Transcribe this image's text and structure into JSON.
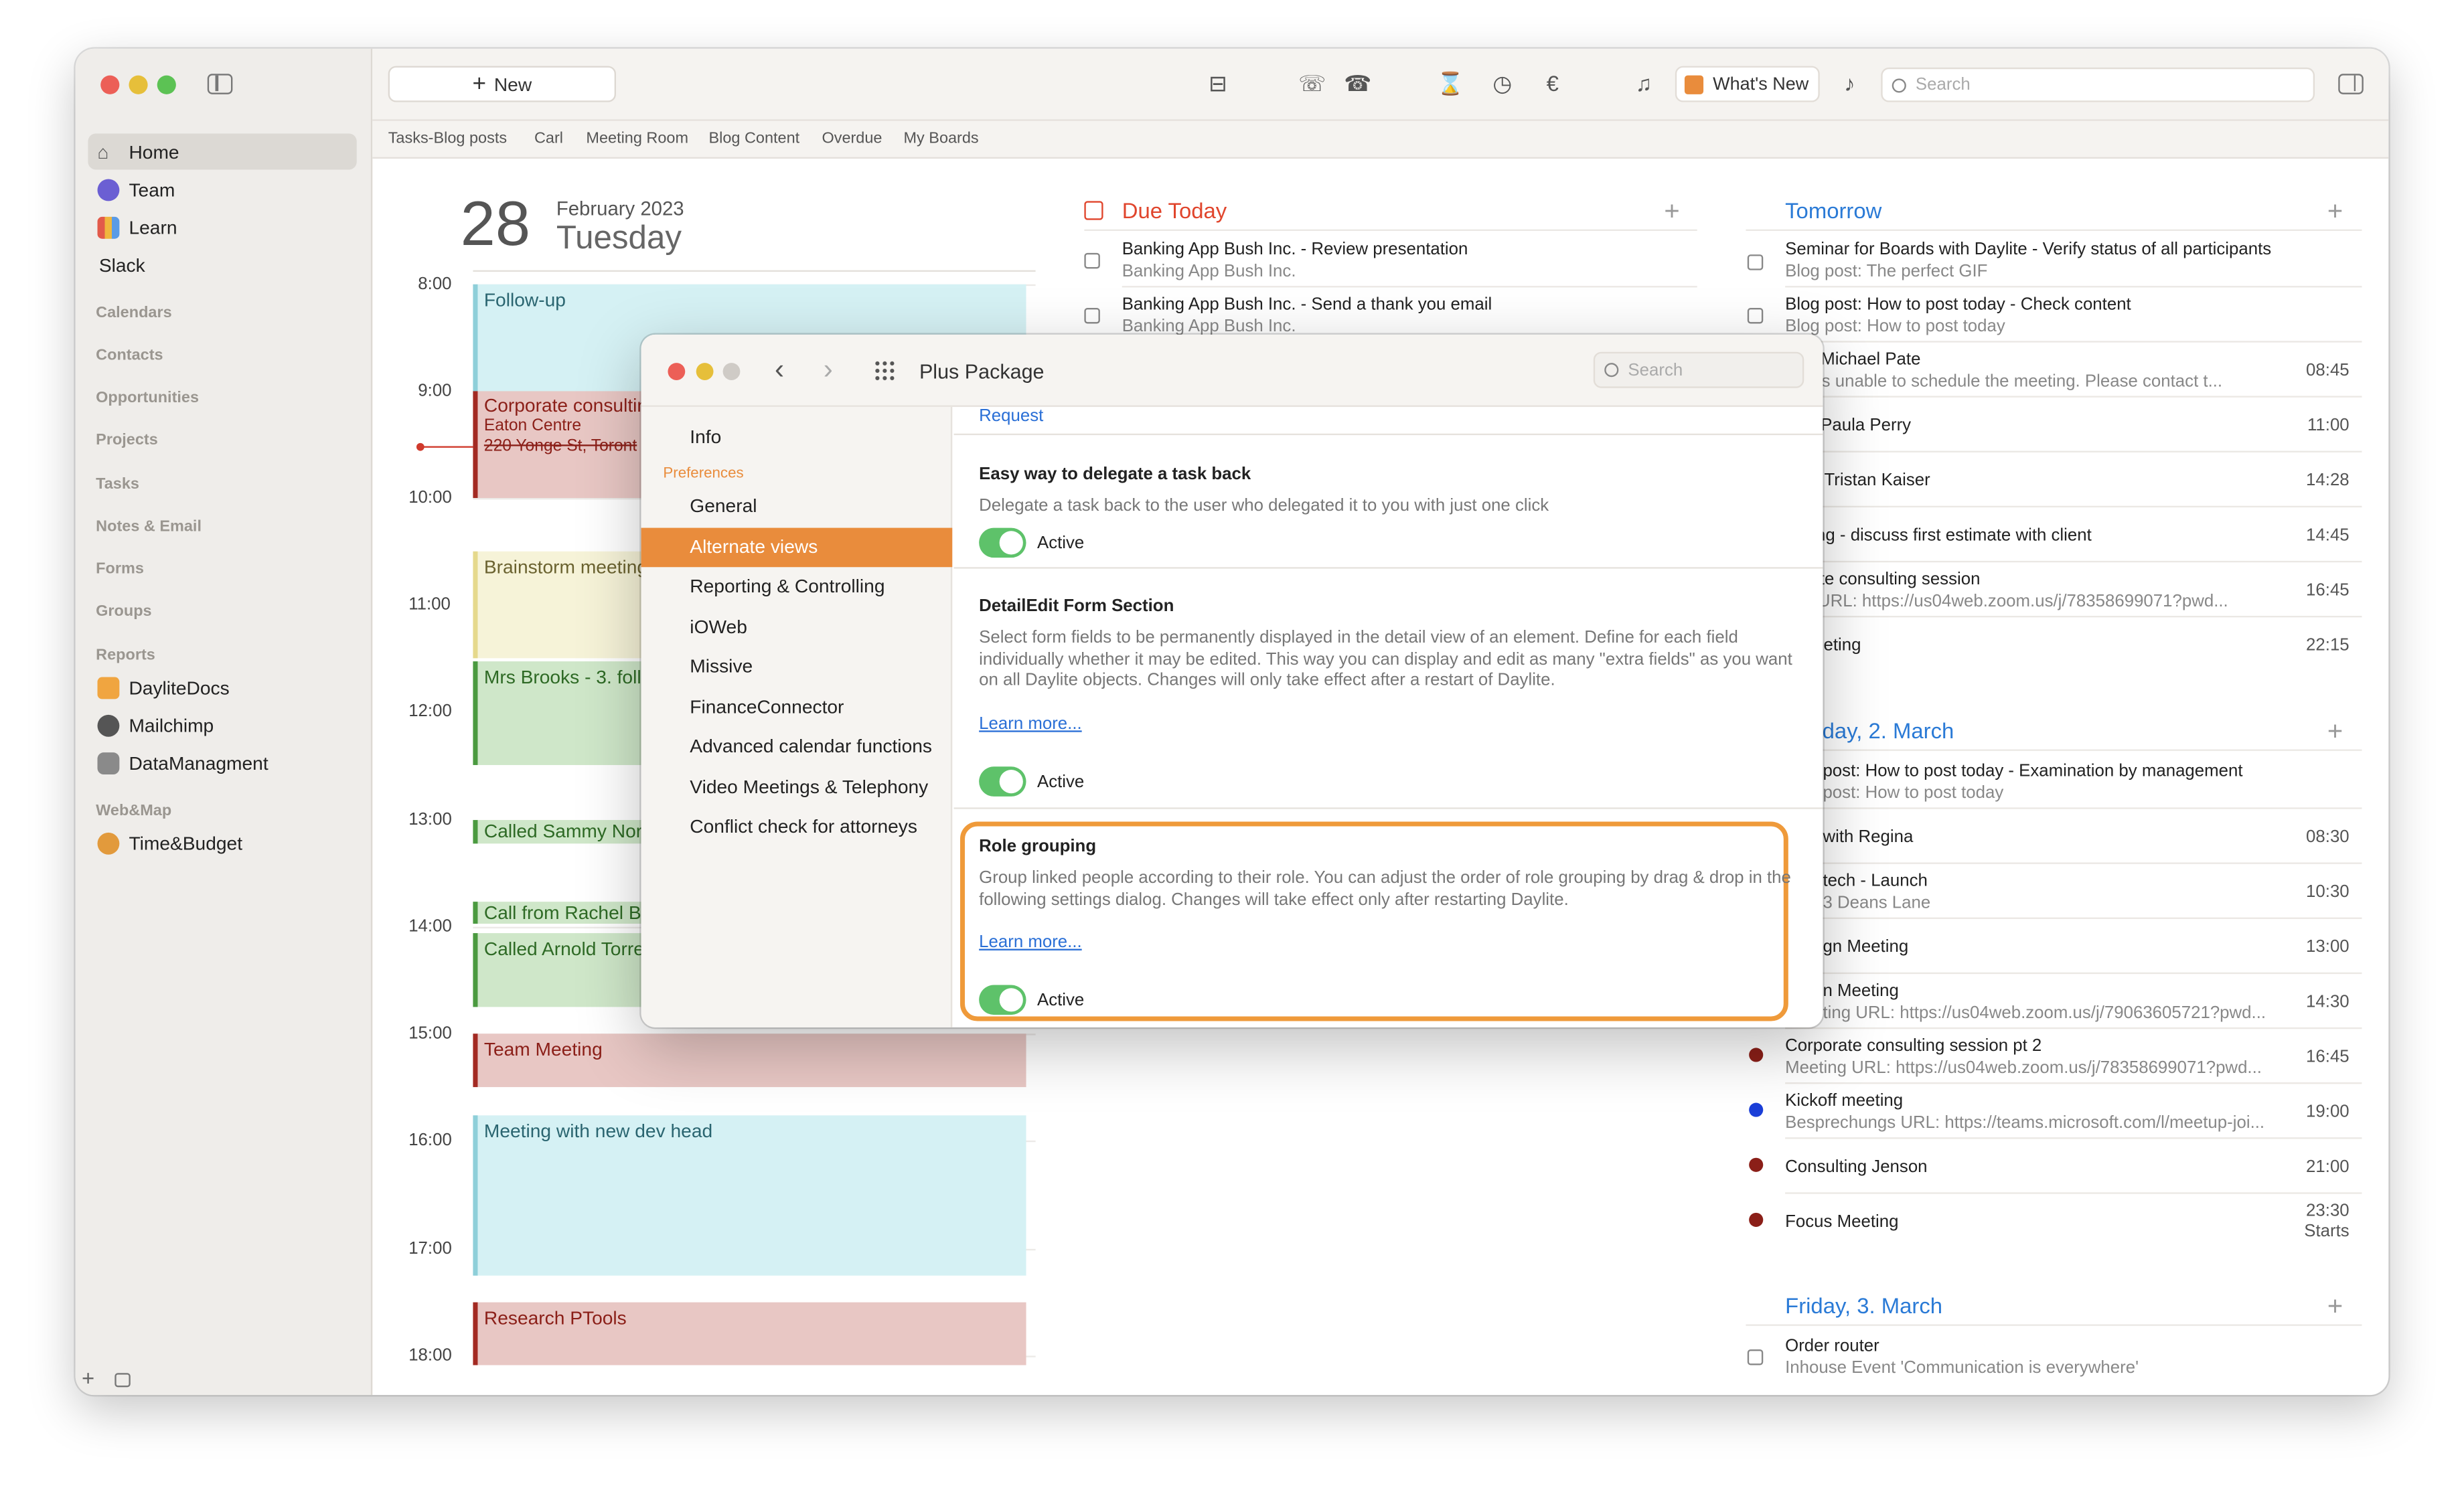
{
  "toolbar": {
    "new_label": "New",
    "whats_new": "What's New",
    "search_placeholder": "Search"
  },
  "tabs": [
    "Tasks-Blog posts",
    "Carl",
    "Meeting Room",
    "Blog Content",
    "Overdue",
    "My Boards"
  ],
  "sidebar": {
    "items": [
      {
        "label": "Home"
      },
      {
        "label": "Team"
      },
      {
        "label": "Learn"
      },
      {
        "label": "Slack"
      }
    ],
    "sections": [
      "Calendars",
      "Contacts",
      "Opportunities",
      "Projects",
      "Tasks",
      "Notes & Email",
      "Forms",
      "Groups",
      "Reports"
    ],
    "reports": [
      {
        "label": "DayliteDocs"
      },
      {
        "label": "Mailchimp"
      },
      {
        "label": "DataManagment"
      }
    ],
    "webmap_label": "Web&Map",
    "webmap": [
      {
        "label": "Time&Budget"
      }
    ]
  },
  "day": {
    "number": "28",
    "month": "February 2023",
    "weekday": "Tuesday"
  },
  "hours": [
    "8:00",
    "9:00",
    "10:00",
    "11:00",
    "12:00",
    "13:00",
    "14:00",
    "15:00",
    "16:00",
    "17:00",
    "18:00"
  ],
  "events": [
    {
      "title": "Follow-up"
    },
    {
      "title": "Corporate consulting",
      "line2": "Eaton Centre",
      "line3": "220 Yonge St, Toront"
    },
    {
      "title": "Brainstorm meeting"
    },
    {
      "title": "Mrs Brooks - 3. follo"
    },
    {
      "title": "Called Sammy Nort"
    },
    {
      "title": "Call from Rachel Bu"
    },
    {
      "title": "Called Arnold Torre"
    },
    {
      "title": "Team Meeting"
    },
    {
      "title": "Meeting with new dev head"
    },
    {
      "title": "Research PTools"
    }
  ],
  "due_today": {
    "title": "Due Today",
    "items": [
      {
        "title": "Banking App Bush Inc. - Review presentation",
        "sub": "Banking App Bush Inc."
      },
      {
        "title": "Banking App Bush Inc. - Send a thank you email",
        "sub": "Banking App Bush Inc."
      }
    ]
  },
  "tomorrow": {
    "title": "Tomorrow",
    "items": [
      {
        "title": "Seminar for Boards with Daylite - Verify status of all participants",
        "sub": "Blog post: The perfect GIF",
        "time": ""
      },
      {
        "title": "Blog post: How to post today - Check content",
        "sub": "Blog post: How to post today",
        "time": ""
      },
      {
        "title": "with Michael Pate",
        "sub": "n was unable to schedule the meeting.  Please contact t...",
        "time": "08:45"
      },
      {
        "title": "with Paula Perry",
        "sub": "",
        "time": "11:00"
      },
      {
        "title": "from Tristan Kaiser",
        "sub": "",
        "time": "14:28"
      },
      {
        "title": "sulting - discuss first estimate with client",
        "sub": "",
        "time": "14:45"
      },
      {
        "title": "porate consulting session",
        "sub": "ting URL: https://us04web.zoom.us/j/78358699071?pwd...",
        "time": "16:45"
      },
      {
        "title": "n Meeting",
        "sub": "",
        "time": "22:15"
      }
    ]
  },
  "thursday": {
    "title": "rsday, 2. March",
    "items": [
      {
        "title": "post: How to post today - Examination by management",
        "sub": "post: How to post today",
        "time": ""
      },
      {
        "title": "with Regina",
        "sub": "",
        "time": "08:30"
      },
      {
        "title": "tech - Launch",
        "sub": "3 Deans Lane",
        "time": "10:30"
      },
      {
        "title": "gn Meeting",
        "sub": "",
        "time": "13:00"
      },
      {
        "title": "n Meeting",
        "sub": "ting URL: https://us04web.zoom.us/j/79063605721?pwd...",
        "time": "14:30"
      },
      {
        "title": "Corporate consulting session pt 2",
        "sub": "Meeting URL: https://us04web.zoom.us/j/78358699071?pwd...",
        "time": "16:45"
      },
      {
        "title": "Kickoff meeting",
        "sub": "Besprechungs URL: https://teams.microsoft.com/l/meetup-joi...",
        "time": "19:00"
      },
      {
        "title": "Consulting Jenson",
        "sub": "",
        "time": "21:00"
      },
      {
        "title": "Focus Meeting",
        "sub": "",
        "time": "23:30",
        "time2": "Starts"
      }
    ]
  },
  "friday": {
    "title": "Friday, 3. March",
    "items": [
      {
        "title": "Order router",
        "sub": "Inhouse Event 'Communication is everywhere'"
      }
    ]
  },
  "dialog": {
    "title": "Plus Package",
    "search_placeholder": "Search",
    "nav_info": "Info",
    "nav_section": "Preferences",
    "nav": [
      "General",
      "Alternate views",
      "Reporting & Controlling",
      "iOWeb",
      "Missive",
      "FinanceConnector",
      "Advanced calendar functions",
      "Video Meetings & Telephony",
      "Conflict check for attorneys"
    ],
    "request_link": "Request",
    "sections": [
      {
        "title": "Easy way to delegate a task back",
        "desc": "Delegate a task back to the user who delegated it to you with just one click",
        "link": "",
        "status": "Active"
      },
      {
        "title": "DetailEdit Form Section",
        "desc": "Select form fields to be permanently displayed in the detail view of an element. Define for each field individually whether it may be edited. This way you can display and edit as many \"extra fields\" as you want on all Daylite objects. Changes will only take effect after a restart of Daylite.",
        "link": "Learn more...",
        "status": "Active"
      },
      {
        "title": "Role grouping",
        "desc": "Group linked people according to their role. You can adjust the order of role grouping by drag & drop in the following settings dialog. Changes will take effect only after restarting Daylite.",
        "link": "Learn more...",
        "status": "Active"
      }
    ]
  },
  "colors": {
    "accent": "#e98c3c",
    "link": "#2a6fd6",
    "due_red": "#e0452c",
    "toggle_on": "#5ec26a"
  }
}
